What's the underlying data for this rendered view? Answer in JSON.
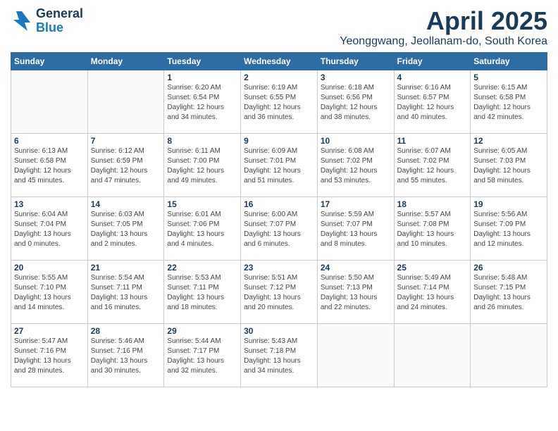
{
  "header": {
    "logo_general": "General",
    "logo_blue": "Blue",
    "month_title": "April 2025",
    "location": "Yeonggwang, Jeollanam-do, South Korea"
  },
  "weekdays": [
    "Sunday",
    "Monday",
    "Tuesday",
    "Wednesday",
    "Thursday",
    "Friday",
    "Saturday"
  ],
  "weeks": [
    [
      {
        "day": "",
        "sunrise": "",
        "sunset": "",
        "daylight": ""
      },
      {
        "day": "",
        "sunrise": "",
        "sunset": "",
        "daylight": ""
      },
      {
        "day": "1",
        "sunrise": "Sunrise: 6:20 AM",
        "sunset": "Sunset: 6:54 PM",
        "daylight": "Daylight: 12 hours and 34 minutes."
      },
      {
        "day": "2",
        "sunrise": "Sunrise: 6:19 AM",
        "sunset": "Sunset: 6:55 PM",
        "daylight": "Daylight: 12 hours and 36 minutes."
      },
      {
        "day": "3",
        "sunrise": "Sunrise: 6:18 AM",
        "sunset": "Sunset: 6:56 PM",
        "daylight": "Daylight: 12 hours and 38 minutes."
      },
      {
        "day": "4",
        "sunrise": "Sunrise: 6:16 AM",
        "sunset": "Sunset: 6:57 PM",
        "daylight": "Daylight: 12 hours and 40 minutes."
      },
      {
        "day": "5",
        "sunrise": "Sunrise: 6:15 AM",
        "sunset": "Sunset: 6:58 PM",
        "daylight": "Daylight: 12 hours and 42 minutes."
      }
    ],
    [
      {
        "day": "6",
        "sunrise": "Sunrise: 6:13 AM",
        "sunset": "Sunset: 6:58 PM",
        "daylight": "Daylight: 12 hours and 45 minutes."
      },
      {
        "day": "7",
        "sunrise": "Sunrise: 6:12 AM",
        "sunset": "Sunset: 6:59 PM",
        "daylight": "Daylight: 12 hours and 47 minutes."
      },
      {
        "day": "8",
        "sunrise": "Sunrise: 6:11 AM",
        "sunset": "Sunset: 7:00 PM",
        "daylight": "Daylight: 12 hours and 49 minutes."
      },
      {
        "day": "9",
        "sunrise": "Sunrise: 6:09 AM",
        "sunset": "Sunset: 7:01 PM",
        "daylight": "Daylight: 12 hours and 51 minutes."
      },
      {
        "day": "10",
        "sunrise": "Sunrise: 6:08 AM",
        "sunset": "Sunset: 7:02 PM",
        "daylight": "Daylight: 12 hours and 53 minutes."
      },
      {
        "day": "11",
        "sunrise": "Sunrise: 6:07 AM",
        "sunset": "Sunset: 7:02 PM",
        "daylight": "Daylight: 12 hours and 55 minutes."
      },
      {
        "day": "12",
        "sunrise": "Sunrise: 6:05 AM",
        "sunset": "Sunset: 7:03 PM",
        "daylight": "Daylight: 12 hours and 58 minutes."
      }
    ],
    [
      {
        "day": "13",
        "sunrise": "Sunrise: 6:04 AM",
        "sunset": "Sunset: 7:04 PM",
        "daylight": "Daylight: 13 hours and 0 minutes."
      },
      {
        "day": "14",
        "sunrise": "Sunrise: 6:03 AM",
        "sunset": "Sunset: 7:05 PM",
        "daylight": "Daylight: 13 hours and 2 minutes."
      },
      {
        "day": "15",
        "sunrise": "Sunrise: 6:01 AM",
        "sunset": "Sunset: 7:06 PM",
        "daylight": "Daylight: 13 hours and 4 minutes."
      },
      {
        "day": "16",
        "sunrise": "Sunrise: 6:00 AM",
        "sunset": "Sunset: 7:07 PM",
        "daylight": "Daylight: 13 hours and 6 minutes."
      },
      {
        "day": "17",
        "sunrise": "Sunrise: 5:59 AM",
        "sunset": "Sunset: 7:07 PM",
        "daylight": "Daylight: 13 hours and 8 minutes."
      },
      {
        "day": "18",
        "sunrise": "Sunrise: 5:57 AM",
        "sunset": "Sunset: 7:08 PM",
        "daylight": "Daylight: 13 hours and 10 minutes."
      },
      {
        "day": "19",
        "sunrise": "Sunrise: 5:56 AM",
        "sunset": "Sunset: 7:09 PM",
        "daylight": "Daylight: 13 hours and 12 minutes."
      }
    ],
    [
      {
        "day": "20",
        "sunrise": "Sunrise: 5:55 AM",
        "sunset": "Sunset: 7:10 PM",
        "daylight": "Daylight: 13 hours and 14 minutes."
      },
      {
        "day": "21",
        "sunrise": "Sunrise: 5:54 AM",
        "sunset": "Sunset: 7:11 PM",
        "daylight": "Daylight: 13 hours and 16 minutes."
      },
      {
        "day": "22",
        "sunrise": "Sunrise: 5:53 AM",
        "sunset": "Sunset: 7:11 PM",
        "daylight": "Daylight: 13 hours and 18 minutes."
      },
      {
        "day": "23",
        "sunrise": "Sunrise: 5:51 AM",
        "sunset": "Sunset: 7:12 PM",
        "daylight": "Daylight: 13 hours and 20 minutes."
      },
      {
        "day": "24",
        "sunrise": "Sunrise: 5:50 AM",
        "sunset": "Sunset: 7:13 PM",
        "daylight": "Daylight: 13 hours and 22 minutes."
      },
      {
        "day": "25",
        "sunrise": "Sunrise: 5:49 AM",
        "sunset": "Sunset: 7:14 PM",
        "daylight": "Daylight: 13 hours and 24 minutes."
      },
      {
        "day": "26",
        "sunrise": "Sunrise: 5:48 AM",
        "sunset": "Sunset: 7:15 PM",
        "daylight": "Daylight: 13 hours and 26 minutes."
      }
    ],
    [
      {
        "day": "27",
        "sunrise": "Sunrise: 5:47 AM",
        "sunset": "Sunset: 7:16 PM",
        "daylight": "Daylight: 13 hours and 28 minutes."
      },
      {
        "day": "28",
        "sunrise": "Sunrise: 5:46 AM",
        "sunset": "Sunset: 7:16 PM",
        "daylight": "Daylight: 13 hours and 30 minutes."
      },
      {
        "day": "29",
        "sunrise": "Sunrise: 5:44 AM",
        "sunset": "Sunset: 7:17 PM",
        "daylight": "Daylight: 13 hours and 32 minutes."
      },
      {
        "day": "30",
        "sunrise": "Sunrise: 5:43 AM",
        "sunset": "Sunset: 7:18 PM",
        "daylight": "Daylight: 13 hours and 34 minutes."
      },
      {
        "day": "",
        "sunrise": "",
        "sunset": "",
        "daylight": ""
      },
      {
        "day": "",
        "sunrise": "",
        "sunset": "",
        "daylight": ""
      },
      {
        "day": "",
        "sunrise": "",
        "sunset": "",
        "daylight": ""
      }
    ]
  ]
}
